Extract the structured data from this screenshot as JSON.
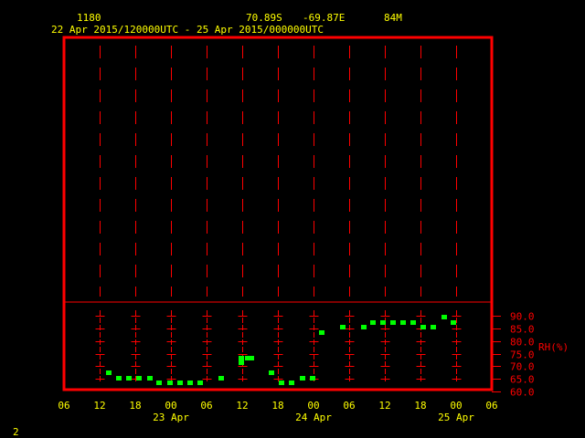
{
  "header": {
    "station": "1180",
    "lat": "70.89S",
    "lon": "-69.87E",
    "elev": "84M",
    "period": "22 Apr 2015/120000UTC - 25 Apr 2015/000000UTC"
  },
  "footer": {
    "page": "2"
  },
  "colors": {
    "frame": "#ff0000",
    "text": "#ffff00",
    "data": "#00ff00"
  },
  "chart_data": {
    "type": "scatter",
    "title": "22 Apr 2015/120000UTC - 25 Apr 2015/000000UTC",
    "xlabel": "",
    "ylabel": "RH(%)",
    "x_units": "hours since 22 Apr 2015 06 UTC",
    "xlim": [
      0,
      72
    ],
    "ylim": [
      60,
      90
    ],
    "x_tick_labels": [
      "06",
      "12",
      "18",
      "00",
      "06",
      "12",
      "18",
      "00",
      "06",
      "12",
      "18",
      "00",
      "06"
    ],
    "date_labels": [
      {
        "hour": 18,
        "label": "23 Apr"
      },
      {
        "hour": 42,
        "label": "24 Apr"
      },
      {
        "hour": 66,
        "label": "25 Apr"
      }
    ],
    "y_tick_labels": [
      "90.0",
      "85.0",
      "80.0",
      "75.0",
      "70.0",
      "65.0",
      "60.0"
    ],
    "y_ticks": [
      90,
      85,
      80,
      75,
      70,
      65,
      60
    ],
    "grid": true,
    "series": [
      {
        "name": "RH",
        "x": [
          7.6,
          9.2,
          10.9,
          12.6,
          14.4,
          16.0,
          17.8,
          19.5,
          21.2,
          22.9,
          26.4,
          29.8,
          29.8,
          30.9,
          31.5,
          34.9,
          36.6,
          38.3,
          40.1,
          41.8,
          43.4,
          46.9,
          50.4,
          52.0,
          53.7,
          55.4,
          57.1,
          58.8,
          60.5,
          62.2,
          64.0,
          65.6
        ],
        "y": [
          67.7,
          65.5,
          65.5,
          65.5,
          65.5,
          63.7,
          63.7,
          63.7,
          63.7,
          63.7,
          65.5,
          71.7,
          73.5,
          73.5,
          73.5,
          67.7,
          63.7,
          63.7,
          65.5,
          65.5,
          83.6,
          85.7,
          85.7,
          87.5,
          87.5,
          87.5,
          87.5,
          87.5,
          85.7,
          85.7,
          89.7,
          87.5
        ]
      }
    ]
  }
}
